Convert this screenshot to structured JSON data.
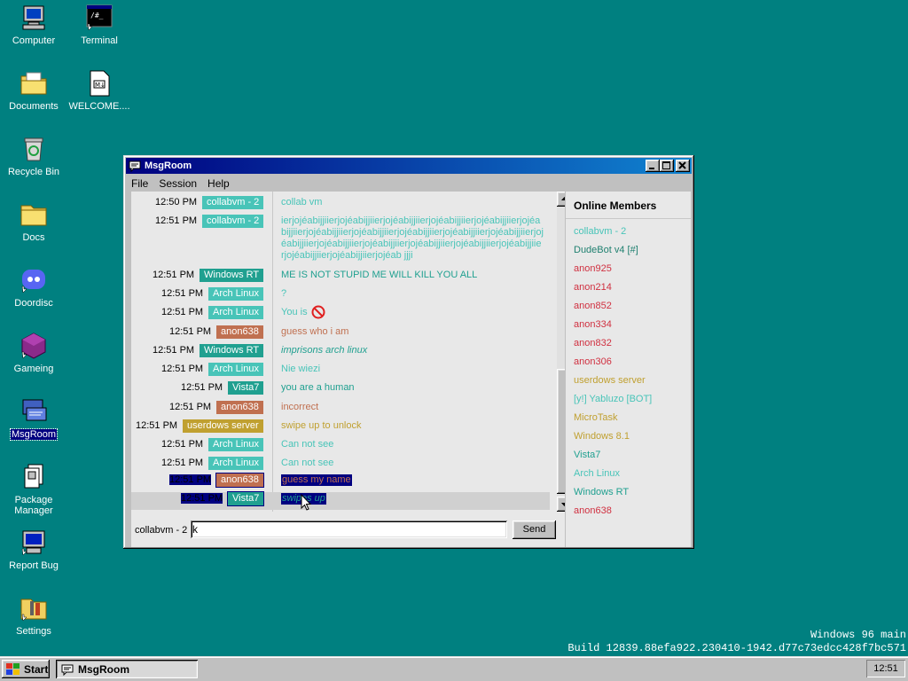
{
  "desktop": {
    "icons": [
      {
        "label": "Computer"
      },
      {
        "label": "Terminal"
      },
      {
        "label": "Documents"
      },
      {
        "label": "WELCOME...."
      },
      {
        "label": "Recycle Bin"
      },
      {
        "label": "Docs"
      },
      {
        "label": "Doordisc"
      },
      {
        "label": "Gameing"
      },
      {
        "label": "MsgRoom"
      },
      {
        "label": "Package Manager"
      },
      {
        "label": "Report Bug"
      },
      {
        "label": "Settings"
      }
    ]
  },
  "window": {
    "title": "MsgRoom",
    "menu": [
      "File",
      "Session",
      "Help"
    ]
  },
  "messages": [
    {
      "time": "12:50 PM",
      "nick": "collabvm - 2",
      "nick_color": "#48c4b8",
      "text": "collab vm",
      "text_color": "#48c4b8"
    },
    {
      "time": "12:51 PM",
      "nick": "collabvm - 2",
      "nick_color": "#48c4b8",
      "text": "ierjojéabijjiierjojéabijjiierjojéabijjiierjojéabijjiierjojéabijjiierjojéabijjiierjojéabijjiierjojéabijjiierjojéabijjiierjojéabijjiierjojéabijjiierjojéabijjiierjojéabijjiierjojéabijjiierjojéabijjiierjojéabijjiierjojéabijjiierjojéabijjiierjojéabijjiierjojéab jjji",
      "text_color": "#48c4b8"
    },
    {
      "time": "12:51 PM",
      "nick": "Windows RT",
      "nick_color": "#20a090",
      "text": "ME IS NOT STUPID ME WILL KILL YOU ALL",
      "text_color": "#20a090"
    },
    {
      "time": "12:51 PM",
      "nick": "Arch Linux",
      "nick_color": "#48c4b8",
      "text": "?",
      "text_color": "#48c4b8"
    },
    {
      "time": "12:51 PM",
      "nick": "Arch Linux",
      "nick_color": "#48c4b8",
      "text": "You is",
      "text_color": "#48c4b8",
      "icon": "prohibited-icon"
    },
    {
      "time": "12:51 PM",
      "nick": "anon638",
      "nick_color": "#c07050",
      "text": "guess who i am",
      "text_color": "#c07050"
    },
    {
      "time": "12:51 PM",
      "nick": "Windows RT",
      "nick_color": "#20a090",
      "text": "imprisons arch linux",
      "text_color": "#20a090",
      "italic": true
    },
    {
      "time": "12:51 PM",
      "nick": "Arch Linux",
      "nick_color": "#48c4b8",
      "text": "Nie wiezi",
      "text_color": "#48c4b8"
    },
    {
      "time": "12:51 PM",
      "nick": "Vista7",
      "nick_color": "#20a090",
      "text": "you are a human",
      "text_color": "#20a090"
    },
    {
      "time": "12:51 PM",
      "nick": "anon638",
      "nick_color": "#c07050",
      "text": "incorrect",
      "text_color": "#c07050"
    },
    {
      "time": "12:51 PM",
      "nick": "userdows server",
      "nick_color": "#c0a030",
      "text": "swipe up to unlock",
      "text_color": "#c0a030"
    },
    {
      "time": "12:51 PM",
      "nick": "Arch Linux",
      "nick_color": "#48c4b8",
      "text": "Can not see",
      "text_color": "#48c4b8"
    },
    {
      "time": "12:51 PM",
      "nick": "Arch Linux",
      "nick_color": "#48c4b8",
      "text": "Can not see",
      "text_color": "#48c4b8"
    },
    {
      "time": "12:51 PM",
      "nick": "anon638",
      "nick_color": "#c07050",
      "text": "guess my name",
      "text_color": "#c07050",
      "selected": true
    },
    {
      "time": "12:51 PM",
      "nick": "Vista7",
      "nick_color": "#20a090",
      "text": "swipes up",
      "text_color": "#20a090",
      "selected": true,
      "italic": true
    }
  ],
  "members": {
    "header": "Online Members",
    "list": [
      {
        "name": "collabvm - 2",
        "color": "#48c4b8"
      },
      {
        "name": "DudeBot v4 [#]",
        "color": "#208070"
      },
      {
        "name": "anon925",
        "color": "#d03040"
      },
      {
        "name": "anon214",
        "color": "#d03040"
      },
      {
        "name": "anon852",
        "color": "#d03040"
      },
      {
        "name": "anon334",
        "color": "#d03040"
      },
      {
        "name": "anon832",
        "color": "#d03040"
      },
      {
        "name": "anon306",
        "color": "#d03040"
      },
      {
        "name": "userdows server",
        "color": "#c0a030"
      },
      {
        "name": "[y!] Yabluzo [BOT]",
        "color": "#48c4b8"
      },
      {
        "name": "MicroTask",
        "color": "#c0a030"
      },
      {
        "name": "Windows 8.1",
        "color": "#c0a030"
      },
      {
        "name": "Vista7",
        "color": "#20a090"
      },
      {
        "name": "Arch Linux",
        "color": "#48c4b8"
      },
      {
        "name": "Windows RT",
        "color": "#20a090"
      },
      {
        "name": "anon638",
        "color": "#d03040"
      }
    ]
  },
  "composer": {
    "current_user": "collabvm - 2",
    "input_value": "k",
    "send_label": "Send"
  },
  "build_info": {
    "line1": "Windows 96 main",
    "line2": "Build 12839.88efa922.230410-1942.d77c73edcc428f7bc571"
  },
  "taskbar": {
    "start_label": "Start",
    "task_label": "MsgRoom",
    "clock": "12:51"
  }
}
